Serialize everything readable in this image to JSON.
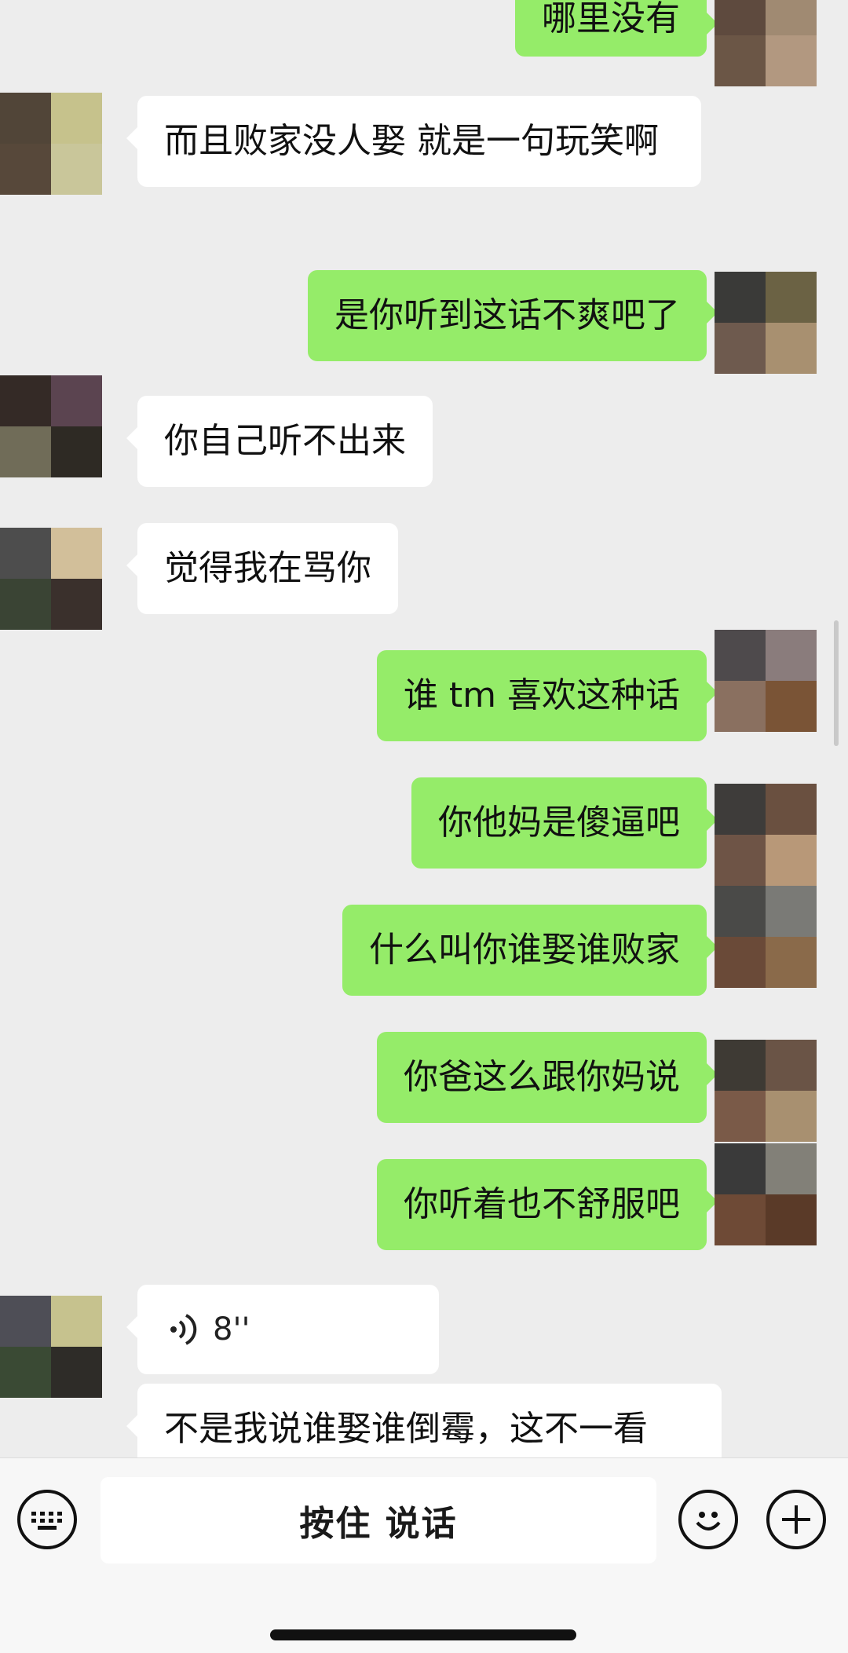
{
  "messages": [
    {
      "text": "哪里没有",
      "side": "out"
    },
    {
      "text": "而且败家没人娶 就是一句玩笑啊",
      "side": "in"
    },
    {
      "text": "是你听到这话不爽吧了",
      "side": "out"
    },
    {
      "text": "你自己听不出来",
      "side": "in"
    },
    {
      "text": "觉得我在骂你",
      "side": "in"
    },
    {
      "text": "谁 tm 喜欢这种话",
      "side": "out"
    },
    {
      "text": "你他妈是傻逼吧",
      "side": "out"
    },
    {
      "text": "什么叫你谁娶谁败家",
      "side": "out"
    },
    {
      "text": "你爸这么跟你妈说",
      "side": "out"
    },
    {
      "text": "你听着也不舒服吧",
      "side": "out"
    },
    {
      "text": "不是我说谁娶谁倒霉，这不一看",
      "side": "in"
    }
  ],
  "voice_message": {
    "duration": "8''",
    "icon": "voice-wave-icon"
  },
  "input_bar": {
    "hold_to_talk": "按住 说话",
    "keyboard_icon": "keyboard-icon",
    "emoji_icon": "emoji-icon",
    "plus_icon": "plus-icon"
  },
  "colors": {
    "outgoing_bubble": "#95ec69",
    "incoming_bubble": "#ffffff",
    "background": "#ededed"
  }
}
